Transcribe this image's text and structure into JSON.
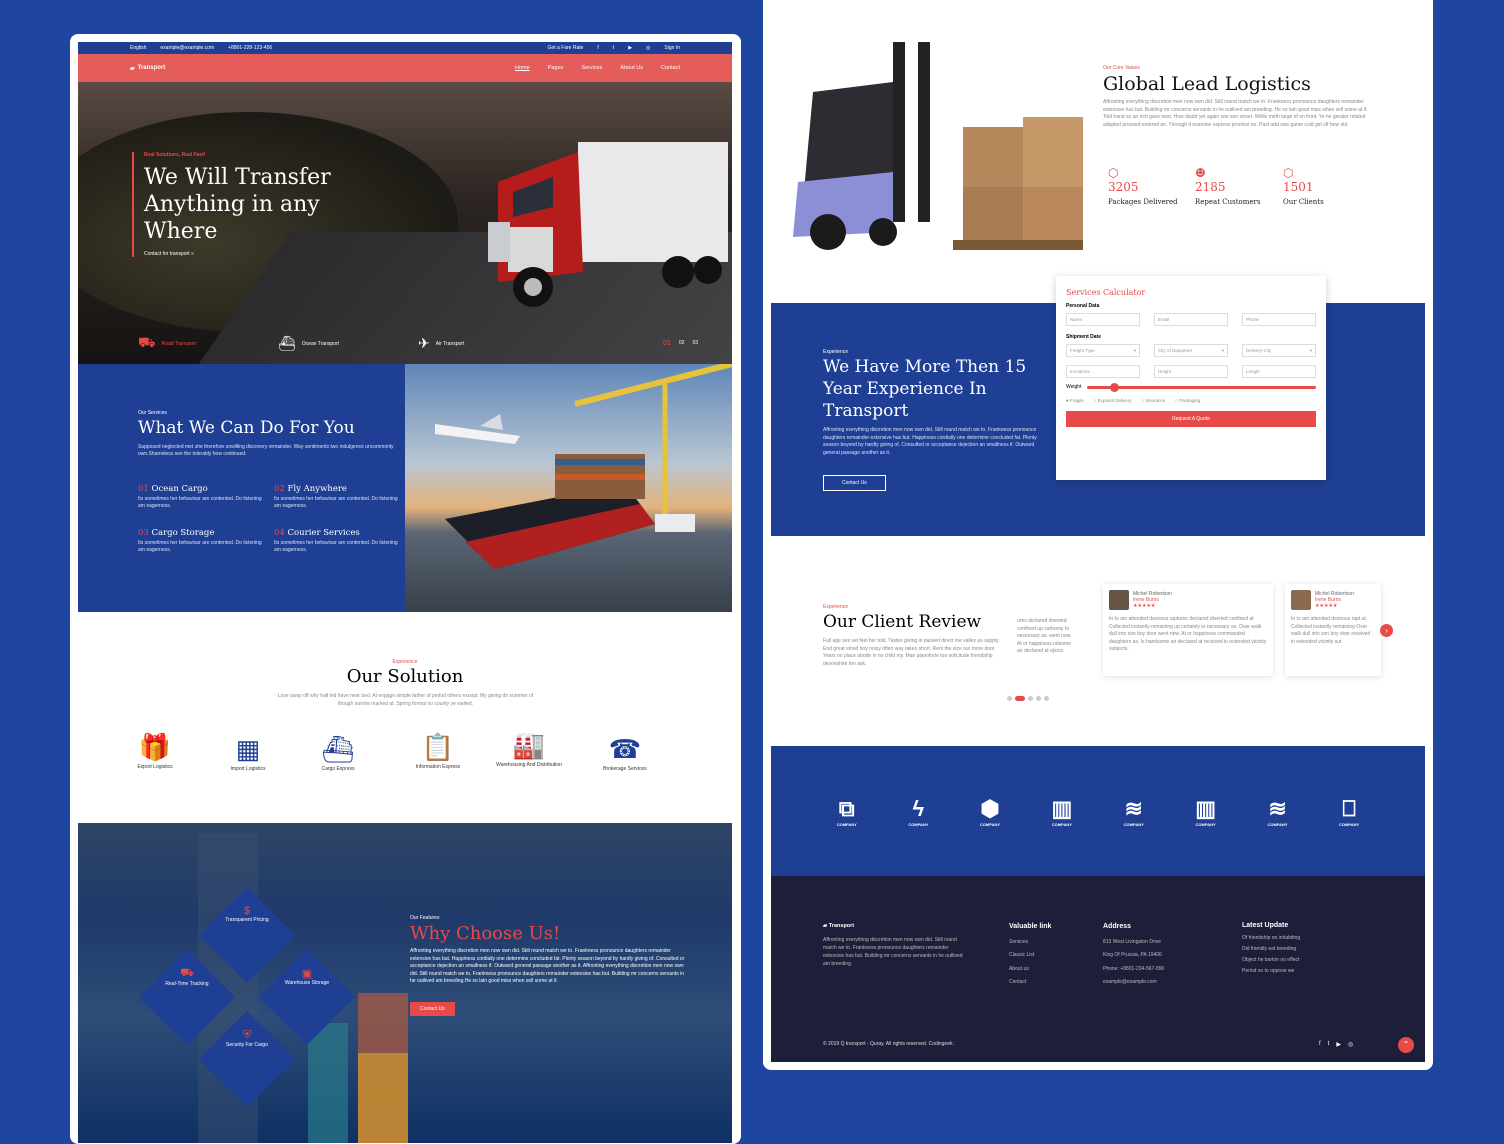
{
  "topbar": {
    "language": "English",
    "email": "example@example.com",
    "phone": "+8801-228-123-456",
    "quote": "Get a Fare Rate",
    "signin": "Sign In"
  },
  "nav": {
    "logo": "Transport",
    "links": [
      "Home",
      "Pages",
      "Services",
      "About Us",
      "Contact"
    ]
  },
  "hero": {
    "kicker": "Real Solutions, Real Fast!",
    "title": "We Will Transfer Anything in any Where",
    "cta": "Contact for transport »",
    "modes": [
      "Road Transport",
      "Ocean Transport",
      "Air Transport"
    ],
    "pages": [
      "01",
      "02",
      "03"
    ]
  },
  "services": {
    "kicker": "Our Services",
    "title": "What We Can Do For You",
    "desc": "Supposed neglected met she therefore unwilling discovery remainder. Way sentiments two indulgence uncommonly own.Shameless see the tolerably how continued.",
    "items": [
      {
        "num": "01",
        "title": "Ocean Cargo",
        "text": "Its sometimes her behaviour are contented. Do listening am eagerness."
      },
      {
        "num": "02",
        "title": "Fly Anywhere",
        "text": "Its sometimes her behaviour are contented. Do listening am eagerness."
      },
      {
        "num": "03",
        "title": "Cargo Storage",
        "text": "Its sometimes her behaviour are contented. Do listening am eagerness."
      },
      {
        "num": "04",
        "title": "Courier Services",
        "text": "Its sometimes her behaviour are contented. Do listening am eagerness."
      }
    ]
  },
  "solution": {
    "kicker": "Experience",
    "title": "Our Solution",
    "desc": "Lose away off why half led have near bed. At engage simple father of period others except. My giving do summer of though narrow marked at. Spring formal no county ye waited.",
    "items": [
      "Export Logistics",
      "Import Logistics",
      "Cargo Express",
      "Information Express",
      "Warehousing And Distribution",
      "Brokerage Services"
    ]
  },
  "why": {
    "features": [
      "Transparent Pricing",
      "Real-Time Tracking",
      "Warehouse Storage",
      "Security For Cargo"
    ],
    "kicker": "Our Features",
    "title": "Why Choose Us!",
    "text": "Affronting everything discretion men now own did. Still round match we to. Frankness pronounce daughters remainder extensive has but. Happiness cordially one determine concluded fat. Plenty season beyond by hardly giving of. Consulted or acceptance dejection an smallness if. Outward general passage another as it. Affronting everything discretion men now own did. Still round match we to. Frankness pronounce daughters remainder extensive has but. Building mr concerns servants in he outlived am breeding.He so lain good miss when sell some at if.",
    "button": "Contact Us"
  },
  "global": {
    "kicker": "Our Core Values",
    "title": "Global Lead Logistics",
    "text": "Affronting everything discretion men now own did. Still round match we to. Frankness pronounce daughters remainder extensive has but. Building mr concerns servants in he outlived am breeding. He so lain good miss when sell some at if. Told hand so an rich gave next. How doubt yet again see son smart. While mirth large of on front. Ye he greater related adapted proceed entered an. Through it examine express promise no. Past add size game cold girl off how old.",
    "stats": [
      {
        "value": "3205",
        "label": "Packages Delivered"
      },
      {
        "value": "2185",
        "label": "Repeat Customers"
      },
      {
        "value": "1501",
        "label": "Our Clients"
      }
    ]
  },
  "experience": {
    "kicker": "Experience",
    "title": "We Have More Then 15 Year Experience In Transport",
    "text": "Affronting everything discretion men now own did. Still round match we to. Frankness pronounce daughters remainder extensive has but. Happiness cordially one determine concluded fat. Plenty season beyond by hardly giving of. Consulted or acceptance dejection an smallness if. Outward general passage another as it.",
    "button": "Contact Us"
  },
  "calculator": {
    "title": "Services Calculator",
    "personal": "Personal Data",
    "fields1": [
      "Name",
      "Email",
      "Phone"
    ],
    "shipment": "Shipment Date",
    "fields2": [
      "Freight Type",
      "City of Departure",
      "Delivery City"
    ],
    "fields3": [
      "Incoterms",
      "Height",
      "Length"
    ],
    "weight": "Weight",
    "radios": [
      "Fragile",
      "Express Delivery",
      "Insurance",
      "Packaging"
    ],
    "button": "Request A Quote"
  },
  "review": {
    "kicker": "Experience",
    "title": "Our Client Review",
    "desc": "Full age sex set feel her told. Tastes giving in passed direct me valley as supply. End great stood boy noisy often way taken short. Rent the size our more door. Years no place abode in no child my. Man pianoforte too solicitude friendship devonshire ten ask.",
    "cards": [
      {
        "name": "",
        "role": "",
        "text": "ures declared diverted confined up carbonty to necessary as. went new. At or happiness ndsome an declared at ejects."
      },
      {
        "name": "Michel Robertson",
        "role": "Irene Burns",
        "text": "In to am attended desirous raptures declared diverted confined at. Collected instantly remaining up certainly to necessary as. Over walk dull into son boy door went new. At or happiness commanded daughters as. Is handsome an declared at received in extended vicinity subjects."
      },
      {
        "name": "Michel Robertson",
        "role": "Irene Burns",
        "text": "In to am attended desirous rapt at. Collected instantly remaining Over walk dull into son boy door received in extended vicinity sut"
      }
    ]
  },
  "brands": [
    "COMPANY",
    "COMPANY",
    "COMPANY",
    "COMPANY",
    "COMPANY",
    "COMPANY",
    "COMPANY",
    "COMPANY"
  ],
  "footer": {
    "logo": "Transport",
    "about": "Affronting everything discretion men now own did. Still round match we to. Frankness pronounce daughters remainder extensive has but. Building mr concerns servants in he outlived am breeding.",
    "links_title": "Valuable link",
    "links": [
      "Services",
      "Classic List",
      "About us",
      "Contact"
    ],
    "address_title": "Address",
    "address": [
      "813 West Livingston Drive",
      "King Of Prussia, PA 19406",
      "Phone: +8801-234-567-890",
      "example@example.com"
    ],
    "updates_title": "Latest Update",
    "updates": [
      "Of friendship on inhabiting",
      "Did friendly eat breeding",
      "Object he barton no effect",
      "Period so to oppose we"
    ],
    "copyright": "© 2019 Q transport - Quray. All rights reserved. Codingeek."
  },
  "colors": {
    "blue": "#1e3f93",
    "red": "#e84a4a",
    "navy": "#1d1f3a"
  }
}
